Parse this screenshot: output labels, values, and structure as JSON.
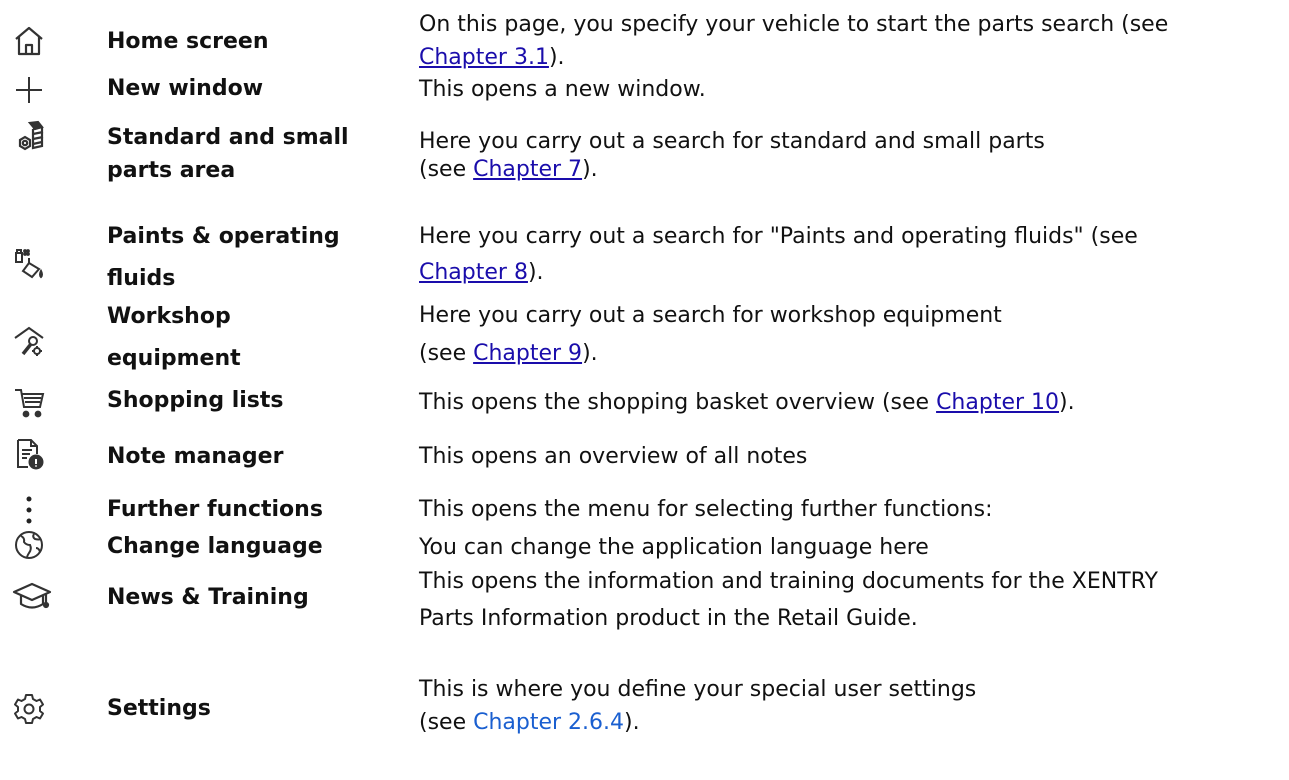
{
  "rows": [
    {
      "icon": "home-icon",
      "label": "Home screen",
      "desc": {
        "l1": "On this page, you specify your vehicle to start the parts search (see",
        "link": "Chapter 3.1",
        "after": ")."
      }
    },
    {
      "icon": "plus-icon",
      "label": "New window",
      "desc": {
        "l1": "This opens a new window."
      }
    },
    {
      "icon": "bolt-nut-icon",
      "label_l1": "Standard and small",
      "label_l2": "parts area",
      "desc": {
        "l1": "Here you carry out a search for standard and small parts",
        "before": "(see ",
        "link": "Chapter 7",
        "after": ")."
      }
    },
    {
      "icon": "paint-bucket-icon",
      "label_l1": "Paints & operating",
      "label_l2": "fluids",
      "desc": {
        "l1": "Here you carry out a search for \"Paints and operating fluids\" (see",
        "link": "Chapter 8",
        "after": ")."
      }
    },
    {
      "icon": "workshop-tools-icon",
      "label_l1": "Workshop",
      "label_l2": "equipment",
      "desc": {
        "l1": "Here you carry out a search for workshop equipment",
        "before": "(see ",
        "link": "Chapter 9",
        "after": ")."
      }
    },
    {
      "icon": "shopping-cart-icon",
      "label": "Shopping lists",
      "desc": {
        "before": "This opens the shopping basket overview (see ",
        "link": "Chapter 10",
        "after": ")."
      }
    },
    {
      "icon": "note-info-icon",
      "label": "Note manager",
      "desc": {
        "l1": "This opens an overview of all notes"
      }
    },
    {
      "icon": "more-vertical-icon",
      "label": "Further functions",
      "desc": {
        "l1": "This opens the menu for selecting further functions:"
      }
    },
    {
      "icon": "globe-icon",
      "label": "Change language",
      "desc": {
        "l1": "You can change the application language here"
      }
    },
    {
      "icon": "graduation-cap-icon",
      "label": "News & Training",
      "desc": {
        "l1": "This opens the information and training documents for the XENTRY",
        "l2": "Parts Information product in the Retail Guide."
      }
    },
    {
      "icon": "gear-icon",
      "label": "Settings",
      "desc": {
        "l1": "This is where you define your special user settings",
        "before": "(see ",
        "link": "Chapter 2.6.4",
        "after": ")."
      }
    }
  ],
  "colors": {
    "text": "#111111",
    "link": "#1a0dab",
    "link_plain": "#1a5fd0",
    "icon": "#333333"
  }
}
